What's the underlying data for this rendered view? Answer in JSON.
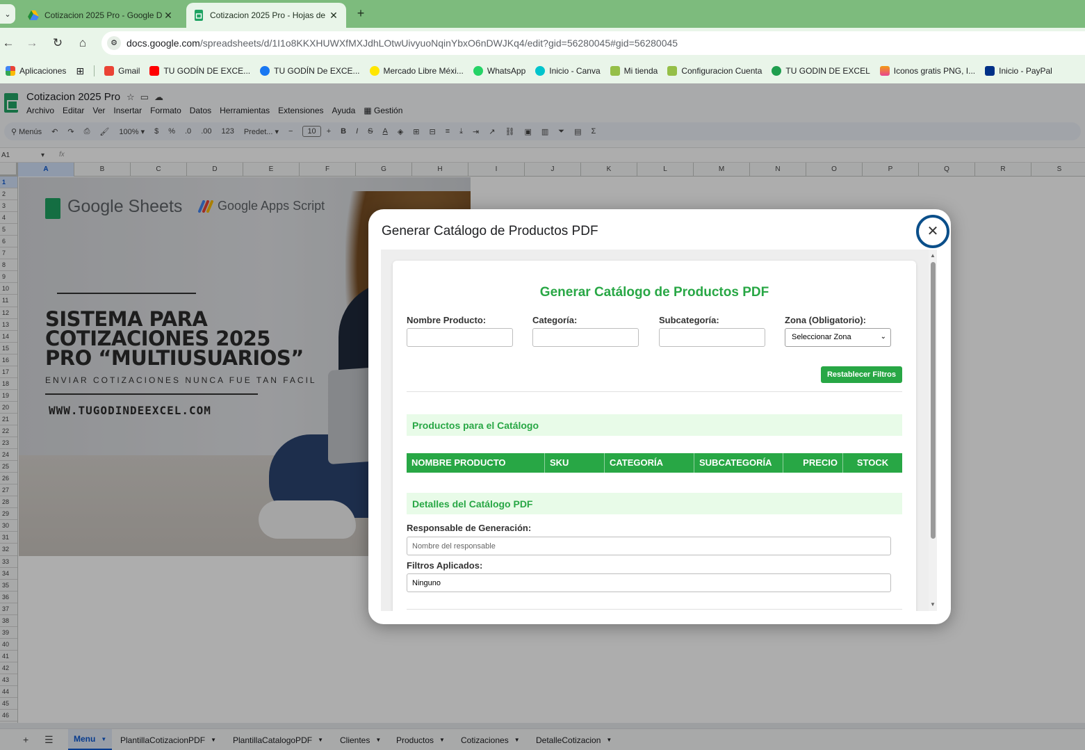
{
  "browser": {
    "tabs": [
      {
        "label": "Cotizacion 2025 Pro - Google D",
        "icon": "google-drive-icon"
      },
      {
        "label": "Cotizacion 2025 Pro - Hojas de",
        "icon": "google-sheets-icon",
        "active": true
      }
    ],
    "url_domain": "docs.google.com",
    "url_path": "/spreadsheets/d/1I1o8KKXHUWXfMXJdhLOtwUivyuoNqinYbxO6nDWJKq4/edit?gid=56280045#gid=56280045",
    "bookmarks": [
      {
        "label": "Aplicaciones",
        "color": "#e94235"
      },
      {
        "label": "Gmail",
        "color": "#ea4335"
      },
      {
        "label": "TU GODÍN DE EXCE...",
        "color": "#ff0000"
      },
      {
        "label": "TU GODÍN De EXCE...",
        "color": "#1877f2"
      },
      {
        "label": "Mercado Libre Méxi...",
        "color": "#ffe600"
      },
      {
        "label": "WhatsApp",
        "color": "#25d366"
      },
      {
        "label": "Inicio - Canva",
        "color": "#00c4cc"
      },
      {
        "label": "Mi tienda",
        "color": "#95bf47"
      },
      {
        "label": "Configuracion Cuenta",
        "color": "#95bf47"
      },
      {
        "label": "TU GODIN DE EXCEL",
        "color": "#1e9e4e"
      },
      {
        "label": "Iconos gratis PNG, I...",
        "color": "#f39c12"
      },
      {
        "label": "Inicio - PayPal",
        "color": "#003087"
      }
    ]
  },
  "sheets": {
    "title": "Cotizacion 2025 Pro",
    "menu": [
      "Archivo",
      "Editar",
      "Ver",
      "Insertar",
      "Formato",
      "Datos",
      "Herramientas",
      "Extensiones",
      "Ayuda",
      "Gestión"
    ],
    "toolbar": {
      "search": "Menús",
      "zoom": "100%",
      "currency": "$",
      "percent": "%",
      "dec_less": ".0",
      "dec_more": ".00",
      "num_format": "123",
      "font": "Predet...",
      "font_size": "10"
    },
    "cell_ref": "A1",
    "fx": "fx",
    "columns": [
      "A",
      "B",
      "C",
      "D",
      "E",
      "F",
      "G",
      "H",
      "I",
      "J",
      "K",
      "L",
      "M",
      "N",
      "O",
      "P",
      "Q",
      "R",
      "S"
    ],
    "rows": [
      "1",
      "2",
      "3",
      "4",
      "5",
      "6",
      "7",
      "8",
      "9",
      "10",
      "11",
      "12",
      "13",
      "14",
      "15",
      "16",
      "17",
      "18",
      "19",
      "20",
      "21",
      "22",
      "23",
      "24",
      "25",
      "26",
      "27",
      "28",
      "29",
      "30",
      "31",
      "32",
      "33",
      "34",
      "35",
      "36",
      "37",
      "38",
      "39",
      "40",
      "41",
      "42",
      "43",
      "44",
      "45",
      "46"
    ],
    "sheet_tabs": [
      "Menu",
      "PlantillaCotizacionPDF",
      "PlantillaCatalogoPDF",
      "Clientes",
      "Productos",
      "Cotizaciones",
      "DetalleCotizacion"
    ]
  },
  "banner": {
    "gs_label": "Google Sheets",
    "gas_label": "Google Apps Script",
    "title_l1": "SISTEMA PARA",
    "title_l2": "COTIZACIONES 2025",
    "title_l3": "PRO “MULTIUSUARIOS”",
    "subtitle": "ENVIAR COTIZACIONES NUNCA FUE TAN FACIL",
    "website": "WWW.TUGODINDEEXCEL.COM"
  },
  "dialog": {
    "title": "Generar Catálogo de Productos PDF",
    "close": "✕",
    "card_title": "Generar Catálogo de Productos PDF",
    "filters": {
      "nombre_label": "Nombre Producto:",
      "categoria_label": "Categoría:",
      "subcategoria_label": "Subcategoría:",
      "zona_label": "Zona (Obligatorio):",
      "zona_selected": "Seleccionar Zona"
    },
    "reset_button": "Restablecer Filtros",
    "products_section": "Productos para el Catálogo",
    "table_headers": [
      "NOMBRE PRODUCTO",
      "SKU",
      "CATEGORÍA",
      "SUBCATEGORÍA",
      "PRECIO",
      "STOCK"
    ],
    "details_section": "Detalles del Catálogo PDF",
    "responsable_label": "Responsable de Generación:",
    "responsable_placeholder": "Nombre del responsable",
    "filtros_label": "Filtros Aplicados:",
    "filtros_value": "Ninguno"
  }
}
